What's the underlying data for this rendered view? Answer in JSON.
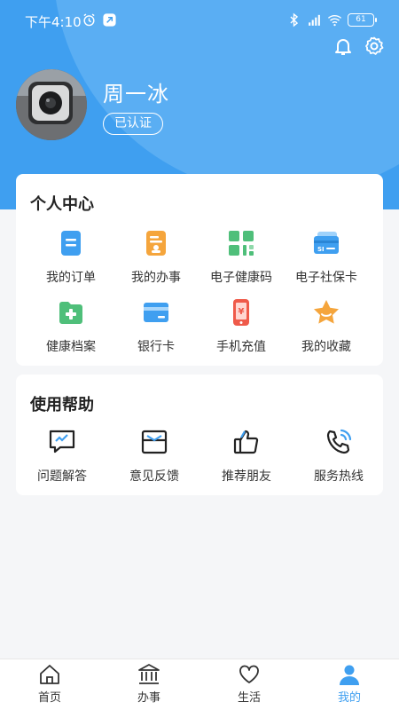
{
  "status_bar": {
    "time": "下午4:10",
    "battery": "61"
  },
  "profile": {
    "name": "周一冰",
    "badge": "已认证"
  },
  "personal_center": {
    "title": "个人中心",
    "items": [
      {
        "label": "我的订单",
        "icon": "order-icon"
      },
      {
        "label": "我的办事",
        "icon": "affairs-icon"
      },
      {
        "label": "电子健康码",
        "icon": "health-code-icon"
      },
      {
        "label": "电子社保卡",
        "icon": "social-security-card-icon"
      },
      {
        "label": "健康档案",
        "icon": "health-record-icon"
      },
      {
        "label": "银行卡",
        "icon": "bank-card-icon"
      },
      {
        "label": "手机充值",
        "icon": "phone-recharge-icon"
      },
      {
        "label": "我的收藏",
        "icon": "favorites-icon"
      }
    ]
  },
  "help": {
    "title": "使用帮助",
    "items": [
      {
        "label": "问题解答",
        "icon": "faq-icon"
      },
      {
        "label": "意见反馈",
        "icon": "feedback-icon"
      },
      {
        "label": "推荐朋友",
        "icon": "thumbs-up-icon"
      },
      {
        "label": "服务热线",
        "icon": "phone-hotline-icon"
      }
    ]
  },
  "tabbar": {
    "items": [
      {
        "label": "首页",
        "icon": "home-icon"
      },
      {
        "label": "办事",
        "icon": "government-building-icon"
      },
      {
        "label": "生活",
        "icon": "heart-icon"
      },
      {
        "label": "我的",
        "icon": "person-icon"
      }
    ],
    "active_color": "#3f9ff0"
  },
  "colors": {
    "brand": "#3f9ff0",
    "background": "#f5f6f8"
  }
}
